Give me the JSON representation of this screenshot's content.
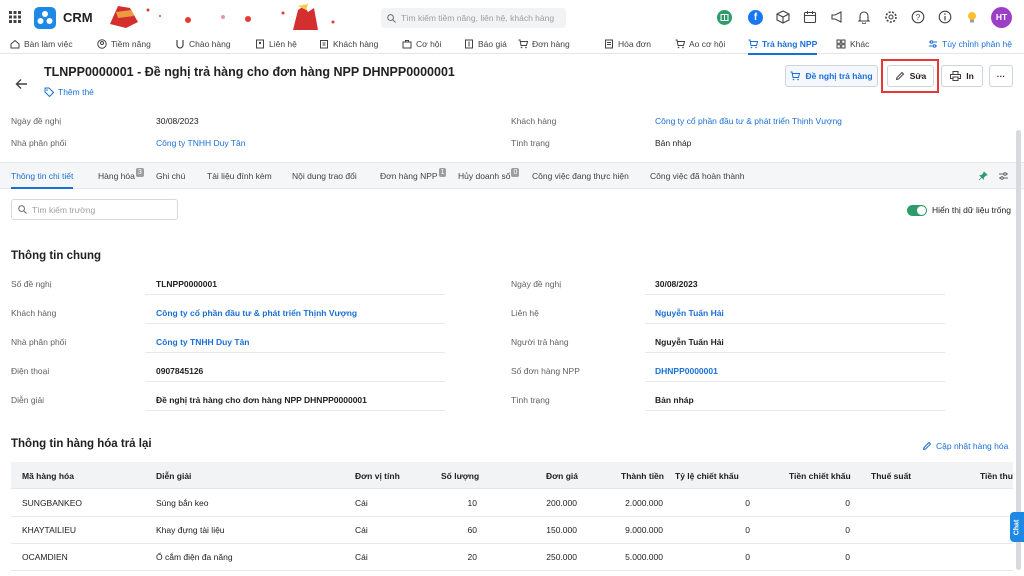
{
  "app": {
    "name": "CRM"
  },
  "search": {
    "placeholder": "Tìm kiếm tiềm năng, liên hệ, khách hàng"
  },
  "user": {
    "initials": "HT"
  },
  "colors": {
    "accent": "#1a6fd6",
    "toggle": "#2e9c6a",
    "avatar": "#9c3fc8",
    "highlight": "#e53935"
  },
  "nav": {
    "items": [
      {
        "label": "Bàn làm việc",
        "icon": "home-icon"
      },
      {
        "label": "Tiềm năng",
        "icon": "user-circle-icon"
      },
      {
        "label": "Chào hàng",
        "icon": "magnet-icon"
      },
      {
        "label": "Liên hệ",
        "icon": "contact-icon"
      },
      {
        "label": "Khách hàng",
        "icon": "building-icon"
      },
      {
        "label": "Cơ hội",
        "icon": "briefcase-icon"
      },
      {
        "label": "Báo giá",
        "icon": "dollar-doc-icon"
      },
      {
        "label": "Đơn hàng",
        "icon": "cart-icon"
      },
      {
        "label": "Hóa đơn",
        "icon": "invoice-icon"
      },
      {
        "label": "Ao cơ hội",
        "icon": "pool-icon"
      },
      {
        "label": "Trả hàng NPP",
        "icon": "return-cart-icon"
      },
      {
        "label": "Khác",
        "icon": "grid-icon"
      }
    ],
    "customize": "Tùy chỉnh phân hệ"
  },
  "record": {
    "title": "TLNPP0000001 - Đề nghị trả hàng cho đơn hàng NPP DHNPP0000001",
    "add_tag": "Thêm thẻ",
    "actions": {
      "propose": "Đề nghị trả hàng",
      "edit": "Sửa",
      "print": "In",
      "more": "···"
    }
  },
  "summary": {
    "left": [
      {
        "label": "Ngày đề nghị",
        "value": "30/08/2023",
        "link": false
      },
      {
        "label": "Nhà phân phối",
        "value": "Công ty TNHH Duy Tân",
        "link": true
      }
    ],
    "right": [
      {
        "label": "Khách hàng",
        "value": "Công ty cổ phần đầu tư & phát triển Thịnh Vượng",
        "link": true
      },
      {
        "label": "Tình trạng",
        "value": "Bản nháp",
        "link": false
      }
    ]
  },
  "tabs": [
    {
      "label": "Thông tin chi tiết",
      "badge": ""
    },
    {
      "label": "Hàng hóa",
      "badge": "3"
    },
    {
      "label": "Ghi chú",
      "badge": ""
    },
    {
      "label": "Tài liệu đính kèm",
      "badge": ""
    },
    {
      "label": "Nội dung trao đổi",
      "badge": ""
    },
    {
      "label": "Đơn hàng NPP",
      "badge": "1"
    },
    {
      "label": "Hủy doanh số",
      "badge": "0"
    },
    {
      "label": "Công việc đang thực hiện",
      "badge": ""
    },
    {
      "label": "Công việc đã hoàn thành",
      "badge": ""
    }
  ],
  "field_search": {
    "placeholder": "Tìm kiếm trường"
  },
  "toggle": {
    "label": "Hiển thị dữ liệu trống",
    "on": true
  },
  "general": {
    "title": "Thông tin chung",
    "left": [
      {
        "label": "Số đề nghị",
        "value": "TLNPP0000001",
        "link": false
      },
      {
        "label": "Khách hàng",
        "value": "Công ty cổ phần đầu tư & phát triển Thịnh Vượng",
        "link": true
      },
      {
        "label": "Nhà phân phối",
        "value": "Công ty TNHH Duy Tân",
        "link": true
      },
      {
        "label": "Điện thoại",
        "value": "0907845126",
        "link": false
      },
      {
        "label": "Diễn giải",
        "value": "Đề nghị trả hàng cho đơn hàng NPP DHNPP0000001",
        "link": false
      }
    ],
    "right": [
      {
        "label": "Ngày đề nghị",
        "value": "30/08/2023",
        "link": false
      },
      {
        "label": "Liên hệ",
        "value": "Nguyễn Tuấn Hải",
        "link": true
      },
      {
        "label": "Người trả hàng",
        "value": "Nguyễn Tuấn Hải",
        "link": false
      },
      {
        "label": "Số đơn hàng NPP",
        "value": "DHNPP0000001",
        "link": true
      },
      {
        "label": "Tình trạng",
        "value": "Bản nháp",
        "link": false
      }
    ]
  },
  "goods": {
    "title": "Thông tin hàng hóa trả lại",
    "update_link": "Cập nhật hàng hóa",
    "columns": [
      "Mã hàng hóa",
      "Diễn giải",
      "Đơn vị tính",
      "Số lượng",
      "Đơn giá",
      "Thành tiền",
      "Tỷ lệ chiết khấu",
      "Tiền chiết khấu",
      "Thuế suất",
      "Tiền thu"
    ],
    "rows": [
      [
        "SUNGBANKEO",
        "Súng bắn keo",
        "Cái",
        "10",
        "200.000",
        "2.000.000",
        "0",
        "0",
        "",
        ""
      ],
      [
        "KHAYTAILIEU",
        "Khay đựng tài liệu",
        "Cái",
        "60",
        "150.000",
        "9.000.000",
        "0",
        "0",
        "",
        ""
      ],
      [
        "OCAMDIEN",
        "Ổ cắm điện đa năng",
        "Cái",
        "20",
        "250.000",
        "5.000.000",
        "0",
        "0",
        "",
        ""
      ]
    ]
  },
  "chat": {
    "label": "Chat"
  }
}
